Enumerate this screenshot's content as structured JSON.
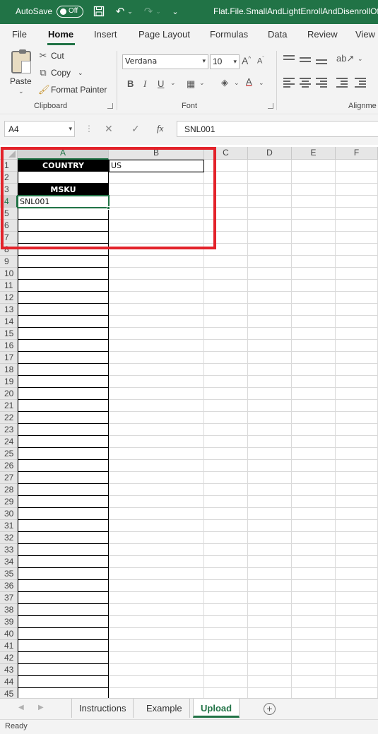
{
  "titlebar": {
    "autosave_label": "AutoSave",
    "autosave_state": "Off",
    "file_title": "Flat.File.SmallAndLightEnrollAndDisenrollOff"
  },
  "ribbon_tabs": [
    "File",
    "Home",
    "Insert",
    "Page Layout",
    "Formulas",
    "Data",
    "Review",
    "View"
  ],
  "ribbon": {
    "clipboard": {
      "paste_label": "Paste",
      "cut_label": "Cut",
      "copy_label": "Copy",
      "format_painter_label": "Format Painter",
      "group_label": "Clipboard"
    },
    "font": {
      "font_name": "Verdana",
      "font_size": "10",
      "group_label": "Font"
    },
    "alignment": {
      "group_label": "Alignme"
    }
  },
  "formula_bar": {
    "name_box": "A4",
    "fx_label": "fx",
    "value": "SNL001"
  },
  "grid": {
    "columns": [
      "A",
      "B",
      "C",
      "D",
      "E",
      "F"
    ],
    "rows": [
      "1",
      "2",
      "3",
      "4",
      "5",
      "6",
      "7",
      "8",
      "9",
      "10",
      "11",
      "12",
      "13",
      "14",
      "15",
      "16",
      "17",
      "18",
      "19",
      "20",
      "21",
      "22",
      "23",
      "24",
      "25",
      "26",
      "27",
      "28",
      "29",
      "30",
      "31",
      "32",
      "33",
      "34",
      "35",
      "36",
      "37",
      "38",
      "39",
      "40",
      "41",
      "42",
      "43",
      "44",
      "45"
    ],
    "cells": {
      "A1": "COUNTRY",
      "B1": "US",
      "A3": "MSKU",
      "A4": "SNL001"
    }
  },
  "sheet_tabs": [
    "Instructions",
    "Example",
    "Upload"
  ],
  "active_sheet": "Upload",
  "status": {
    "text": "Ready"
  },
  "colors": {
    "excel_green": "#217346",
    "highlight_red": "#e3222a"
  }
}
